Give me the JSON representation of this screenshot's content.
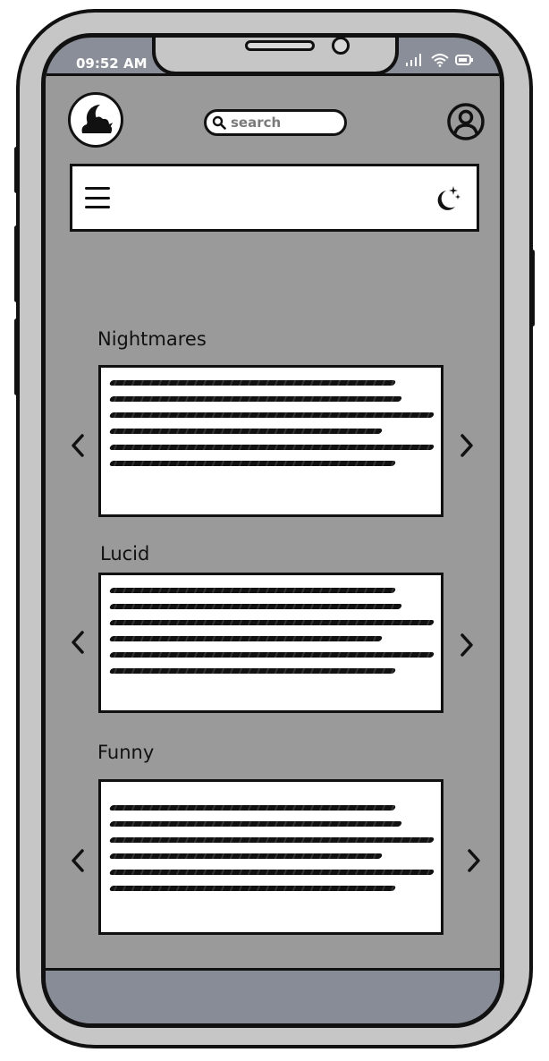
{
  "status_bar": {
    "time": "09:52 AM"
  },
  "header": {
    "search_placeholder": "search",
    "logo_icon": "moon-cloud-icon",
    "profile_icon": "user-icon"
  },
  "navbar": {
    "menu_icon": "hamburger-icon",
    "theme_icon": "moon-stars-icon"
  },
  "sections": [
    {
      "title": "Nightmares",
      "lines": 6
    },
    {
      "title": "Lucid",
      "lines": 6
    },
    {
      "title": "Funny",
      "lines": 6
    }
  ],
  "colors": {
    "frame": "#c6c6c6",
    "screen_bg": "#9a9a9a",
    "bars": "#878c97",
    "outline": "#111111"
  }
}
